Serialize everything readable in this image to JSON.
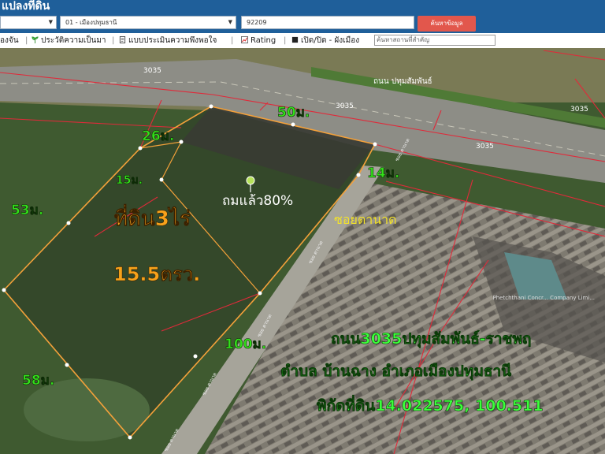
{
  "header": {
    "title": "แปลงที่ดิน",
    "select_1": "",
    "select_2": "01 - เมืองปทุมธานี",
    "parcel_input": "92209",
    "search_button": "ค้นหาข้อมูล"
  },
  "toolbar": {
    "item1": "องจัน",
    "item2": "ประวัติความเป็นมา",
    "item3": "แบบประเมินความพึงพอใจ",
    "item4": "Rating",
    "item5": "เปิด/ปิด - ผังเมือง",
    "search_placeholder": "ค้นหาสถานที่สำคัญ"
  },
  "map": {
    "road_3035_labels": [
      "3035",
      "3035",
      "3035",
      "3035"
    ],
    "road_name": "ถนน ปทุมสัมพันธ์",
    "soi_labels": [
      "ซอย ตานาด",
      "ซอย ตานาด",
      "ซอย ตานาด",
      "ซอย ตานาด",
      "ซอย ตานาด"
    ],
    "company_label": "Phetchthani Concr... Company Limi...",
    "dimensions": {
      "top_50": "50ม.",
      "top_26": "26ม.",
      "inner_15": "15ม.",
      "right_14": "14ม.",
      "left_53": "53ม.",
      "left_58": "58ม.",
      "bottom_100": "100ม."
    },
    "area_title": "ที่ดิน3ไร่",
    "area_sub": "15.5ตรว.",
    "fill_note": "ถมแล้ว80%",
    "soi_name": "ซอยตานาด",
    "info_line1": "ถนน3035ปทุมสัมพันธ์-ราชพฤ",
    "info_line2": "ตำบล บ้านฉาง อำเภอเมืองปทุมธานี",
    "info_line3": "พิกัดที่ดิน14.022575, 100.511",
    "colors": {
      "header_bg": "#1f5f9a",
      "search_button": "#e2574c",
      "dimension_text": "#33e01a",
      "area_text": "#f7a21b",
      "soi_text": "#f2e22a",
      "parcel_outline": "#f4a13a",
      "cadastral_line": "#e02a3a"
    }
  }
}
